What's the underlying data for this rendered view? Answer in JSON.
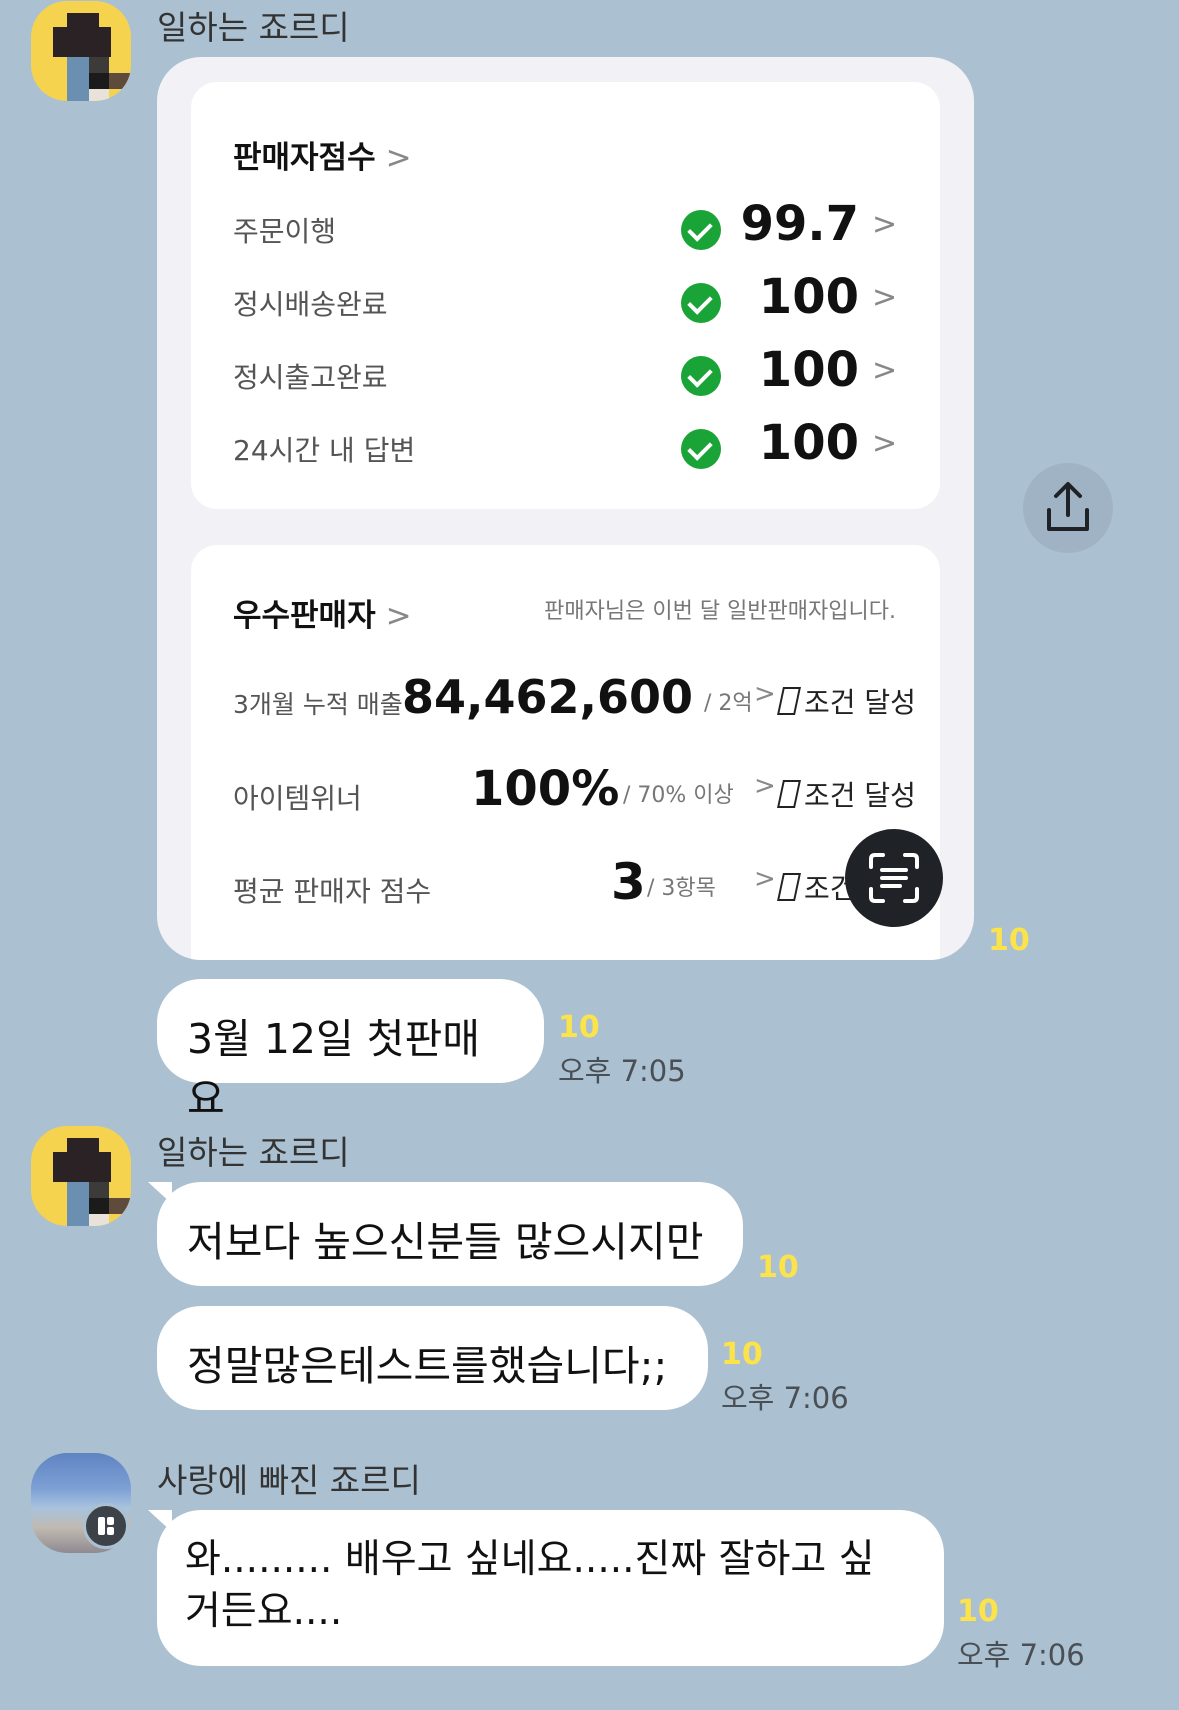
{
  "messages": {
    "first_sender": "일하는 죠르디",
    "screenshot": {
      "seller_score": {
        "title": "판매자점수",
        "rows": [
          {
            "label": "주문이행",
            "value": "99.7"
          },
          {
            "label": "정시배송완료",
            "value": "100"
          },
          {
            "label": "정시출고완료",
            "value": "100"
          },
          {
            "label": "24시간 내 답변",
            "value": "100"
          }
        ]
      },
      "top_seller": {
        "title": "우수판매자",
        "note": "판매자님은 이번 달 일반판매자입니다.",
        "rows": [
          {
            "label": "3개월 누적 매출",
            "value": "84,462,600",
            "target": "/ 2억",
            "status": "조건 달성"
          },
          {
            "label": "아이템위너",
            "value": "100%",
            "target": "/ 70% 이상",
            "status": "조건 달성"
          },
          {
            "label": "평균 판매자 점수",
            "value": "3",
            "target": "/ 3항목",
            "status": "조건"
          }
        ]
      },
      "unread": "10"
    },
    "msg1": {
      "text": "3월 12일 첫판매요",
      "unread": "10",
      "time": "오후 7:05"
    },
    "second_sender": "일하는 죠르디",
    "msg2": {
      "text": "저보다 높으신분들 많으시지만",
      "unread": "10"
    },
    "msg3": {
      "text": "정말많은테스트를했습니다;;",
      "unread": "10",
      "time": "오후 7:06"
    },
    "third_sender": "사랑에 빠진 죠르디",
    "msg4": {
      "line1": "와......... 배우고 싶네요.....진짜 잘하고 싶",
      "line2": "거든요....",
      "unread": "10",
      "time": "오후 7:06"
    }
  },
  "icons": {
    "share": "share-icon",
    "scan": "text-scan-icon"
  }
}
